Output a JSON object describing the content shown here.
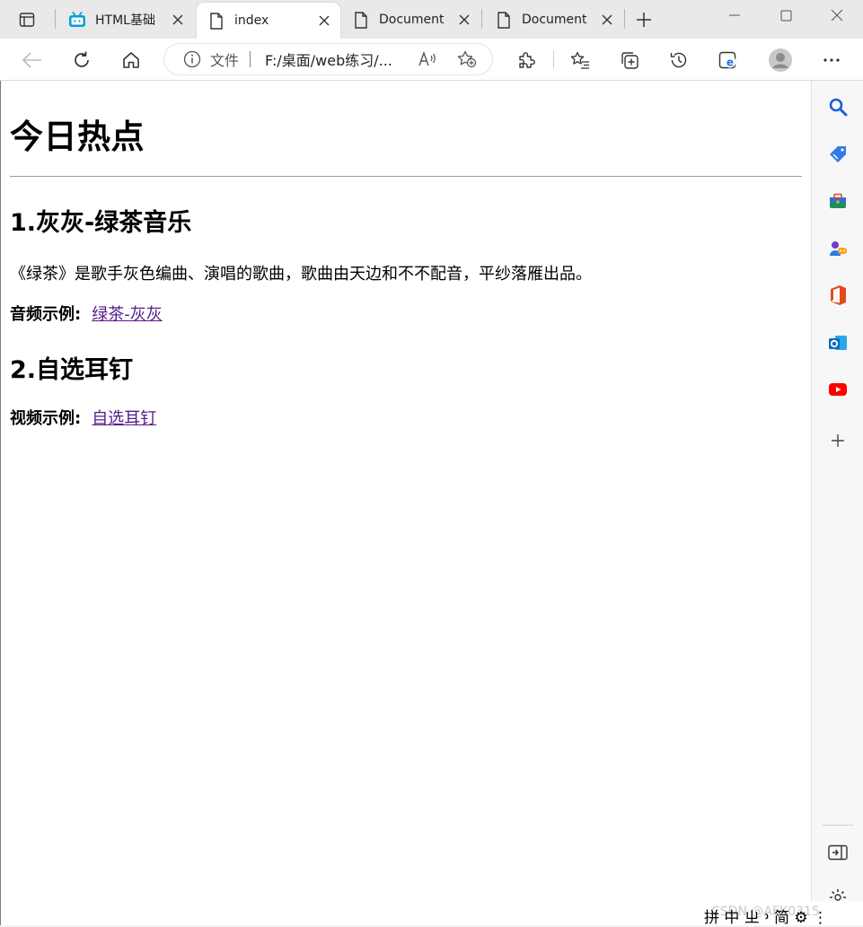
{
  "tabs": [
    {
      "label": "HTML基础",
      "icon": "bilibili-icon",
      "active": false
    },
    {
      "label": "index",
      "icon": "page-icon",
      "active": true
    },
    {
      "label": "Document",
      "icon": "page-icon",
      "active": false
    },
    {
      "label": "Document",
      "icon": "page-icon",
      "active": false
    }
  ],
  "address": {
    "protocol": "文件",
    "url": "F:/桌面/web练习/..."
  },
  "page": {
    "title": "今日热点",
    "item1_heading": "1.灰灰-绿茶音乐",
    "item1_desc": "《绿茶》是歌手灰色编曲、演唱的歌曲，歌曲由天边和不不配音，平纱落雁出品。",
    "audio_label": "音频示例:",
    "audio_link": "绿茶-灰灰",
    "item2_heading": "2.自选耳钉",
    "video_label": "视频示例:",
    "video_link": "自选耳钉"
  },
  "ime": {
    "text": "拼 中 ㄓ ᠈ 简 ⚙ ⋮",
    "watermark": "CSDN @AFK0315"
  },
  "colors": {
    "link_visited": "#551a8b",
    "bilibili": "#00a1d6",
    "edge_blue": "#1a73e8"
  }
}
